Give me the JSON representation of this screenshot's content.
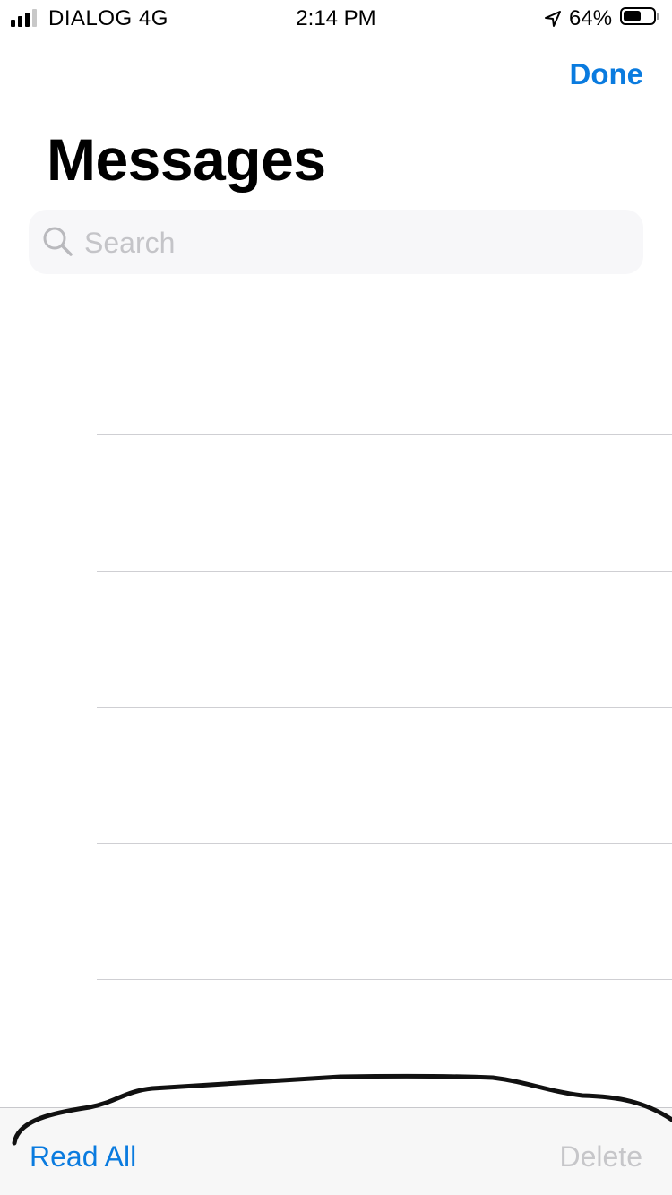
{
  "status_bar": {
    "carrier": "DIALOG 4G",
    "time": "2:14 PM",
    "battery_percent_label": "64%",
    "battery_level": 0.64,
    "signal_bars": 4,
    "signal_bars_active": 3,
    "location_icon": "location-arrow-icon"
  },
  "nav": {
    "done_label": "Done",
    "title": "Messages"
  },
  "search": {
    "placeholder": "Search",
    "value": "",
    "icon": "magnifier-icon"
  },
  "message_list": {
    "row_count": 5
  },
  "toolbar": {
    "read_all_label": "Read All",
    "delete_label": "Delete",
    "delete_enabled": false
  },
  "colors": {
    "accent": "#0a7bdf",
    "disabled": "#c6c6c9",
    "separator": "#cfcfd3",
    "search_bg": "#f7f7f9"
  }
}
